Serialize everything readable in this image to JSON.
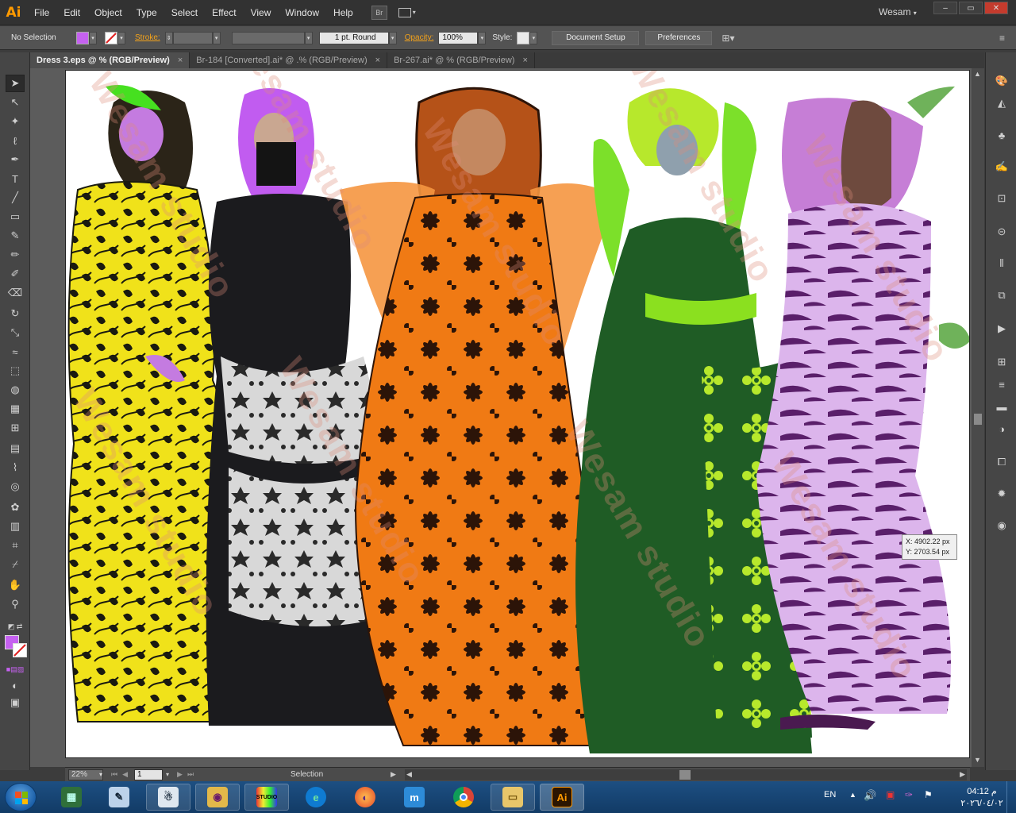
{
  "app": {
    "logo": "Ai",
    "user": "Wesam"
  },
  "menu": [
    "File",
    "Edit",
    "Object",
    "Type",
    "Select",
    "Effect",
    "View",
    "Window",
    "Help"
  ],
  "bridge_button": "Br",
  "window_controls": {
    "minimize": "–",
    "restore": "▭",
    "close": "✕"
  },
  "control_bar": {
    "selection": "No Selection",
    "fill_color": "#c561f0",
    "stroke_label": "Stroke:",
    "stroke_profile": "1 pt. Round",
    "opacity_label": "Opacity:",
    "opacity_value": "100%",
    "style_label": "Style:",
    "document_setup": "Document Setup",
    "preferences": "Preferences"
  },
  "tabs": [
    {
      "label": "Dress 3.eps @ % (RGB/Preview)",
      "active": true
    },
    {
      "label": "Br-184 [Converted].ai* @ .% (RGB/Preview)",
      "active": false
    },
    {
      "label": "Br-267.ai* @ % (RGB/Preview)",
      "active": false
    }
  ],
  "tools": [
    "selection-tool",
    "direct-selection-tool",
    "magic-wand-tool",
    "lasso-tool",
    "pen-tool",
    "type-tool",
    "line-tool",
    "rectangle-tool",
    "paintbrush-tool",
    "pencil-tool",
    "blob-brush-tool",
    "eraser-tool",
    "rotate-tool",
    "scale-tool",
    "warp-tool",
    "free-transform-tool",
    "shape-builder-tool",
    "perspective-grid-tool",
    "mesh-tool",
    "gradient-tool",
    "eyedropper-tool",
    "blend-tool",
    "symbol-sprayer-tool",
    "column-graph-tool",
    "artboard-tool",
    "slice-tool",
    "hand-tool",
    "zoom-tool"
  ],
  "canvas": {
    "watermark": "Wesam studio",
    "coord_x": "X: 4902.22 px",
    "coord_y": "Y: 2703.54 px"
  },
  "status_bar": {
    "zoom": "22%",
    "page": "1",
    "tool": "Selection"
  },
  "taskbar": {
    "apps": [
      "monitor-app",
      "pen-app",
      "wizard-app",
      "eye-app",
      "studio-app",
      "edge-app",
      "firefox-app",
      "maxthon-app",
      "chrome-app",
      "explorer-app",
      "illustrator-app"
    ],
    "studio_label": "STUDIO",
    "ai_label": "Ai",
    "lang": "EN",
    "time": "04:12 م",
    "date": "٢٠٢٦/٠٤/٠٢"
  },
  "colors": {
    "accent": "#ff9a00",
    "fill": "#c561f0",
    "taskbar": "#1d4f82"
  }
}
